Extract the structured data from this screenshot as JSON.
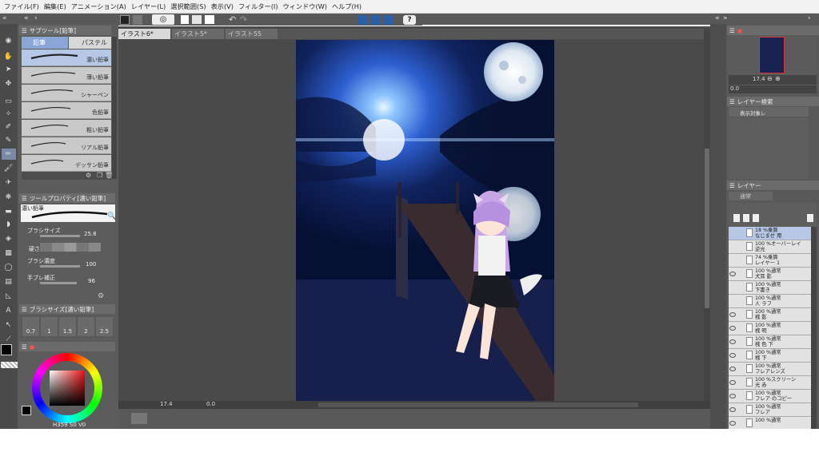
{
  "menu": [
    "ファイル(F)",
    "編集(E)",
    "アニメーション(A)",
    "レイヤー(L)",
    "選択範囲(S)",
    "表示(V)",
    "フィルター(I)",
    "ウィンドウ(W)",
    "ヘルプ(H)"
  ],
  "subtool": {
    "header": "サブツール[鉛筆]",
    "tab_pencil": "鉛筆",
    "tab_pastel": "パステル",
    "brushes": [
      "濃い鉛筆",
      "薄い鉛筆",
      "シャーペン",
      "色鉛筆",
      "粗い鉛筆",
      "リアル鉛筆",
      "デッサン鉛筆"
    ]
  },
  "toolprop": {
    "header": "ツールプロパティ[濃い鉛筆]",
    "brush_name": "濃い鉛筆",
    "brush_size_label": "ブラシサイズ",
    "brush_size_value": "25.8",
    "hardness_label": "硬さ",
    "density_label": "ブラシ濃度",
    "density_value": "100",
    "stabilization_label": "手ブレ補正",
    "stabilization_value": "96"
  },
  "brushsize": {
    "header": "ブラシサイズ[濃い鉛筆]",
    "sizes": [
      "0.7",
      "1",
      "1.5",
      "2",
      "2.5"
    ]
  },
  "color": {
    "h": "359",
    "s": "0",
    "v": "0"
  },
  "tabs": [
    "イラスト6*",
    "イラスト5*",
    "イラスト55"
  ],
  "canvas_status": {
    "zoom": "17.4",
    "angle": "0.0"
  },
  "navigator": {
    "zoom": "17.4",
    "angle": "0.0"
  },
  "layer_search": {
    "header": "レイヤー検索",
    "filter": "表示対象レ"
  },
  "layer_panel": {
    "header": "レイヤー",
    "blend": "通常"
  },
  "layers": [
    {
      "l1": "18 %乗算",
      "l2": "なじませ 用",
      "hidden": true
    },
    {
      "l1": "100 %オーバーレイ",
      "l2": "逆光",
      "hidden": true
    },
    {
      "l1": "74 %乗算",
      "l2": "レイヤー 1",
      "hidden": true
    },
    {
      "l1": "100 %通常",
      "l2": "犬耳 影",
      "hidden": false
    },
    {
      "l1": "100 %通常",
      "l2": "下書き",
      "hidden": true
    },
    {
      "l1": "100 %通常",
      "l2": "人 ラフ",
      "hidden": true
    },
    {
      "l1": "100 %通常",
      "l2": "桟 影",
      "hidden": false
    },
    {
      "l1": "100 %通常",
      "l2": "桟 明",
      "hidden": false
    },
    {
      "l1": "100 %通常",
      "l2": "桟 色 下",
      "hidden": false
    },
    {
      "l1": "100 %通常",
      "l2": "桟 下",
      "hidden": false
    },
    {
      "l1": "100 %通常",
      "l2": "フレアレンズ",
      "hidden": false
    },
    {
      "l1": "100 %スクリーン",
      "l2": "光 赤",
      "hidden": false
    },
    {
      "l1": "100 %通常",
      "l2": "フレア のコピー",
      "hidden": false
    },
    {
      "l1": "100 %通常",
      "l2": "フレア",
      "hidden": false
    },
    {
      "l1": "100 %通常",
      "l2": "",
      "hidden": false
    }
  ],
  "colors": {
    "accent": "#2a6ad0",
    "sky_top": "#070d2c",
    "sky_glow": "#3a7cff"
  }
}
